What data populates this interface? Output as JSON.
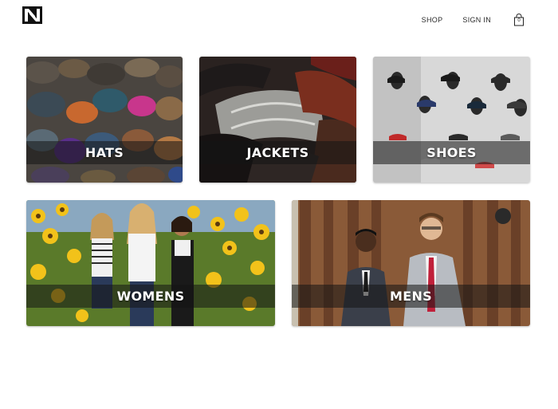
{
  "header": {
    "logo": "N",
    "nav": [
      {
        "label": "SHOP"
      },
      {
        "label": "SIGN IN"
      }
    ],
    "cart": {
      "icon": "shopping-bag-icon",
      "count": "0"
    }
  },
  "categories": [
    {
      "title": "HATS"
    },
    {
      "title": "JACKETS"
    },
    {
      "title": "SHOES"
    },
    {
      "title": "WOMENS"
    },
    {
      "title": "MENS"
    }
  ]
}
